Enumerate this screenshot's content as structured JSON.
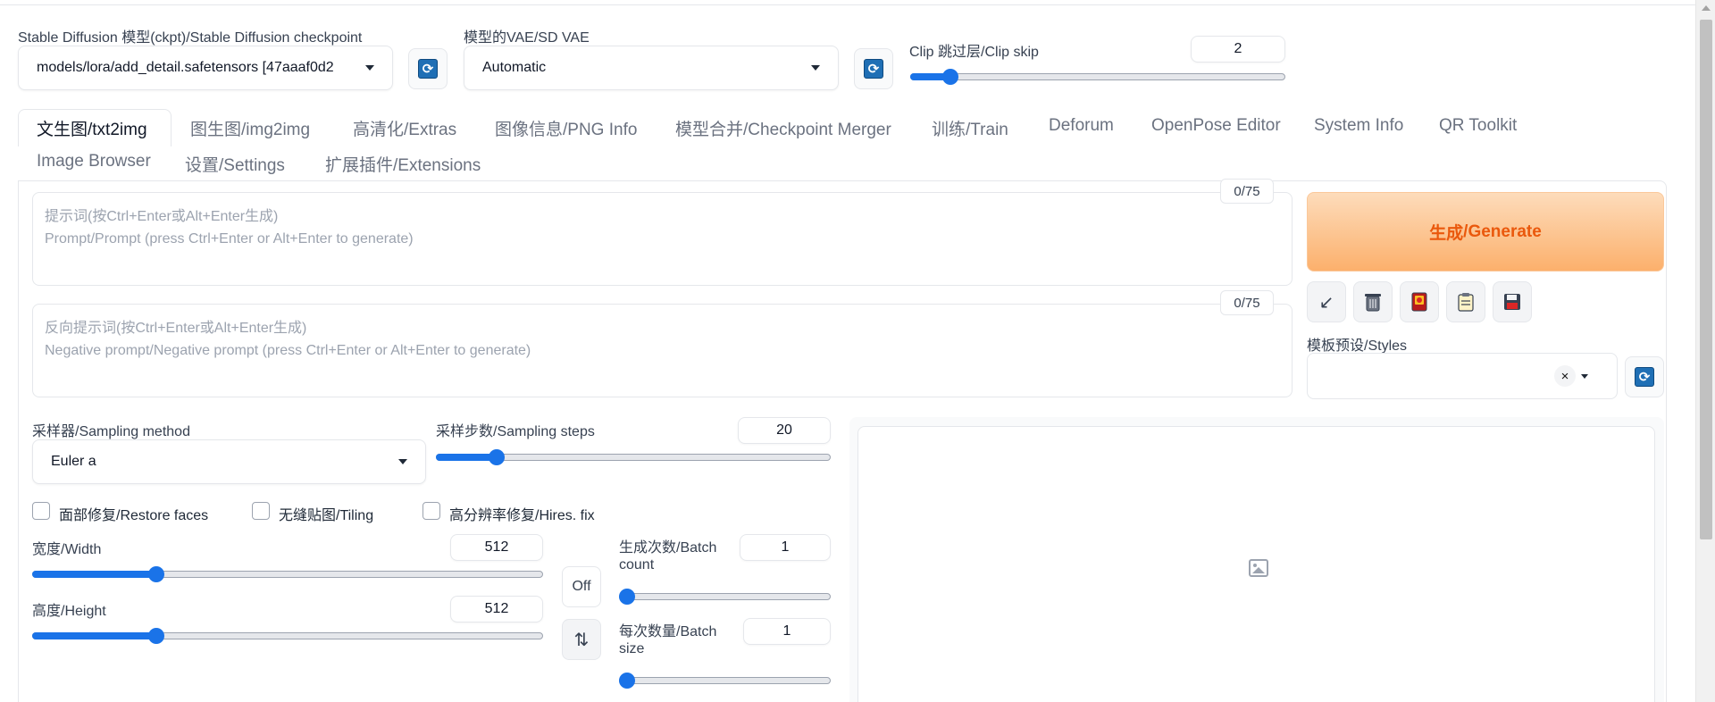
{
  "header": {
    "checkpoint_label": "Stable Diffusion 模型(ckpt)/Stable Diffusion checkpoint",
    "checkpoint_value": "models/lora/add_detail.safetensors [47aaaf0d2",
    "vae_label": "模型的VAE/SD VAE",
    "vae_value": "Automatic",
    "clip_label": "Clip 跳过层/Clip skip",
    "clip_value": "2"
  },
  "tabs": [
    "文生图/txt2img",
    "图生图/img2img",
    "高清化/Extras",
    "图像信息/PNG Info",
    "模型合并/Checkpoint Merger",
    "训练/Train",
    "Deforum",
    "OpenPose Editor",
    "System Info",
    "QR Toolkit",
    "Image Browser",
    "设置/Settings",
    "扩展插件/Extensions"
  ],
  "prompt": {
    "placeholder_line1": "提示词(按Ctrl+Enter或Alt+Enter生成)",
    "placeholder_line2": "Prompt/Prompt (press Ctrl+Enter or Alt+Enter to generate)",
    "counter": "0/75"
  },
  "negative_prompt": {
    "placeholder_line1": "反向提示词(按Ctrl+Enter或Alt+Enter生成)",
    "placeholder_line2": "Negative prompt/Negative prompt (press Ctrl+Enter or Alt+Enter to generate)",
    "counter": "0/75"
  },
  "generate": {
    "label_cn": "生成",
    "label_en": "/Generate"
  },
  "tools": [
    "arrow-icon",
    "trash-icon",
    "card-icon",
    "clipboard-icon",
    "save-icon"
  ],
  "styles": {
    "label": "模板预设/Styles",
    "clear": "×"
  },
  "sampling": {
    "method_label": "采样器/Sampling method",
    "method_value": "Euler a",
    "steps_label": "采样步数/Sampling steps",
    "steps_value": "20",
    "steps_fraction": 0.14
  },
  "checkboxes": {
    "restore_faces": "面部修复/Restore faces",
    "tiling": "无缝贴图/Tiling",
    "hires_fix": "高分辨率修复/Hires. fix"
  },
  "dimensions": {
    "width_label": "宽度/Width",
    "width_value": "512",
    "width_fraction": 0.235,
    "height_label": "高度/Height",
    "height_value": "512",
    "height_fraction": 0.235,
    "off_label": "Off",
    "swap_icon": "⇅"
  },
  "batch": {
    "count_label_line1": "生成次数/Batch",
    "count_label_line2": "count",
    "count_value": "1",
    "size_label_line1": "每次数量/Batch",
    "size_label_line2": "size",
    "size_value": "1"
  },
  "clip_skip_fraction": 0.09,
  "colors": {
    "accent": "#1a73e8",
    "generate_text": "#ea580c"
  }
}
